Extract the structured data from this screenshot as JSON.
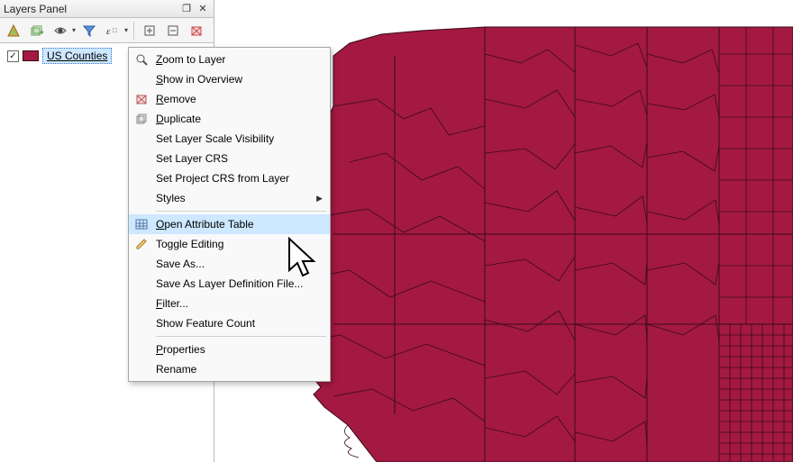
{
  "panel": {
    "title": "Layers Panel",
    "dock_icon": "❐",
    "close_icon": "✕"
  },
  "toolbar": {
    "items": [
      {
        "name": "style-manager-icon"
      },
      {
        "name": "add-group-icon"
      },
      {
        "name": "manage-visibility-icon",
        "dropdown": true
      },
      {
        "name": "filter-legend-icon"
      },
      {
        "name": "expression-filter-icon",
        "dropdown": true
      },
      {
        "name": "expand-all-icon"
      },
      {
        "name": "collapse-all-icon"
      },
      {
        "name": "remove-layer-icon"
      }
    ]
  },
  "layer": {
    "checked": true,
    "name": "US Counties",
    "swatch_color": "#a31941"
  },
  "menu": {
    "items": [
      {
        "label": "Zoom to Layer",
        "accel": "Z",
        "icon": "zoom"
      },
      {
        "label": "Show in Overview",
        "accel": "S"
      },
      {
        "label": "Remove",
        "accel": "R",
        "icon": "remove"
      },
      {
        "label": "Duplicate",
        "accel": "D",
        "icon": "duplicate"
      },
      {
        "label": "Set Layer Scale Visibility"
      },
      {
        "label": "Set Layer CRS"
      },
      {
        "label": "Set Project CRS from Layer"
      },
      {
        "label": "Styles",
        "submenu": true
      },
      {
        "sep": true
      },
      {
        "label": "Open Attribute Table",
        "accel": "O",
        "icon": "table",
        "highlight": true
      },
      {
        "label": "Toggle Editing",
        "icon": "pencil"
      },
      {
        "label": "Save As..."
      },
      {
        "label": "Save As Layer Definition File..."
      },
      {
        "label": "Filter...",
        "accel": "F"
      },
      {
        "label": "Show Feature Count"
      },
      {
        "sep": true
      },
      {
        "label": "Properties",
        "accel": "P"
      },
      {
        "label": "Rename"
      }
    ]
  },
  "chart_data": null
}
